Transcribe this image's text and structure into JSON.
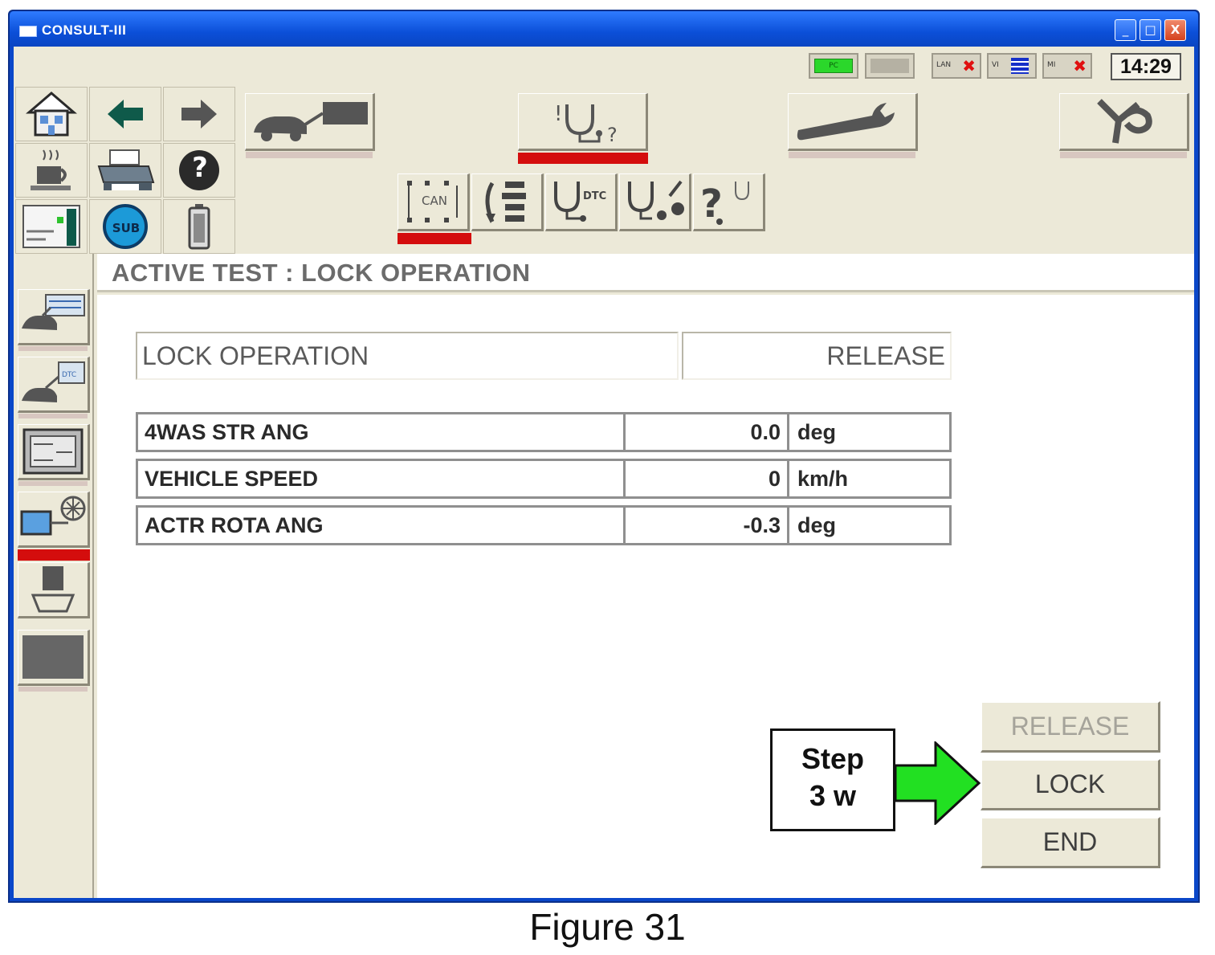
{
  "window": {
    "title": "CONSULT-III",
    "minimize_label": "_",
    "maximize_label": "□",
    "close_label": "X"
  },
  "statusbar": {
    "pc_label": "PC",
    "lan_label": "LAN",
    "vi_label": "VI",
    "mi_label": "MI",
    "time": "14:29"
  },
  "icon_grid": {
    "sub_label": "SUB",
    "help_glyph": "?"
  },
  "toolbar": {
    "dtc_label": "DTC",
    "can_label": "CAN"
  },
  "page": {
    "title": "ACTIVE TEST : LOCK OPERATION"
  },
  "status": {
    "label": "LOCK OPERATION",
    "value": "RELEASE"
  },
  "data_rows": [
    {
      "name": "4WAS STR ANG",
      "value": "0.0",
      "unit": "deg"
    },
    {
      "name": "VEHICLE SPEED",
      "value": "0",
      "unit": "km/h"
    },
    {
      "name": "ACTR ROTA ANG",
      "value": "-0.3",
      "unit": "deg"
    }
  ],
  "actions": {
    "release_label": "RELEASE",
    "lock_label": "LOCK",
    "end_label": "END"
  },
  "annotation": {
    "step_line1": "Step",
    "step_line2": "3 w",
    "arrow_color": "#22e022"
  },
  "caption": "Figure 31",
  "colors": {
    "accent_red": "#d40d0d",
    "titlebar_blue": "#0b4fd8",
    "panel_bg": "#ece9d8"
  }
}
